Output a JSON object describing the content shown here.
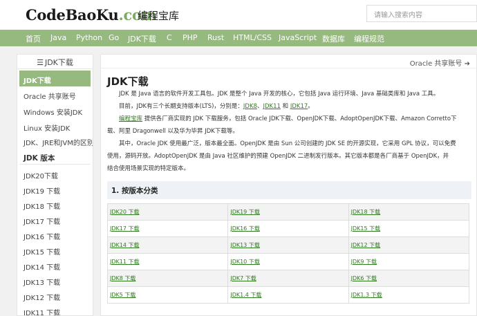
{
  "header": {
    "logo_main": "CodeBaoKu",
    "logo_suffix": ".com",
    "logo_cn": "编程宝库",
    "search_placeholder": "请输入搜索内容"
  },
  "nav": [
    "首页",
    "Java",
    "Python",
    "Go",
    "JDK下载",
    "C",
    "PHP",
    "Rust",
    "HTML/CSS",
    "JavaScript",
    "数据库",
    "编程规范"
  ],
  "sidebar": {
    "heading_icon": "menu-icon",
    "heading": "JDK下载",
    "items_top": [
      "JDK下载",
      "Oracle 共享账号",
      "Windows 安装JDK",
      "Linux 安装JDK",
      "JDK、JRE和JVM的区别"
    ],
    "section": "JDK 版本",
    "items_versions": [
      "JDK20下载",
      "JDK19 下载",
      "JDK18 下载",
      "JDK17 下载",
      "JDK16 下载",
      "JDK15 下载",
      "JDK14 下载",
      "JDK13 下载",
      "JDK12 下载",
      "JDK11 下载"
    ]
  },
  "main": {
    "next_link": "Oracle 共享账号",
    "next_icon": "arrow-right-icon",
    "title": "JDK下载",
    "p1": "JDK 是 Java 语言的软件开发工具包。JDK 是整个 Java 开发的核心，它包括 Java 运行环境、Java 基础类库和 Java 工具。",
    "p2_prefix": "目前，JDK有三个长期支持版本(LTS)，分别是：",
    "p2_link1": "JDK8",
    "p2_sep1": "、",
    "p2_link2": "JDK11",
    "p2_sep2": " 和 ",
    "p2_link3": "JDK17",
    "p2_suffix": "。",
    "p3_link": "编程宝库",
    "p3_line1": " 提供各厂商实现的 JDK 下载服务，包括 Oracle JDK下载、OpenJDK下载、AdoptOpenJDK下载、Amazon Corretto下",
    "p3_line2": "载、阿里 Dragonwell 以及华为毕昇 JDK下载等。",
    "p4_line1": "其中，Oracle JDK 使用最广泛，版本最全面。OpenJDK 是由 Sun 公司创建的 JDK SE 的开源实现，它采用 GPL 协议，可以免费",
    "p4_line2": "使用，源码开放。AdoptOpenJDK 是由 Java 社区维护的预建 OpenJDK 二进制发行版本。其它版本都是各厂商基于 OpenJDK，并",
    "p4_line3": "结合使用场景实现的特定版本。",
    "section_title": "1. 按版本分类",
    "downloads": [
      [
        "JDK20 下载",
        "JDK19 下载",
        "JDK18 下载"
      ],
      [
        "JDK17 下载",
        "JDK16 下载",
        "JDK15 下载"
      ],
      [
        "JDK14 下载",
        "JDK13 下载",
        "JDK12 下载"
      ],
      [
        "JDK11 下载",
        "JDK10 下载",
        "JDK9 下载"
      ],
      [
        "JDK8 下载",
        "JDK7 下载",
        "JDK6 下载"
      ],
      [
        "JDK5 下载",
        "JDK1.4 下载",
        "JDK1.3 下载"
      ]
    ]
  },
  "colors": {
    "nav_bg": "#96b97f",
    "accent": "#7bab65",
    "link": "#2f7a1f",
    "section_bg": "#eef2f7"
  }
}
